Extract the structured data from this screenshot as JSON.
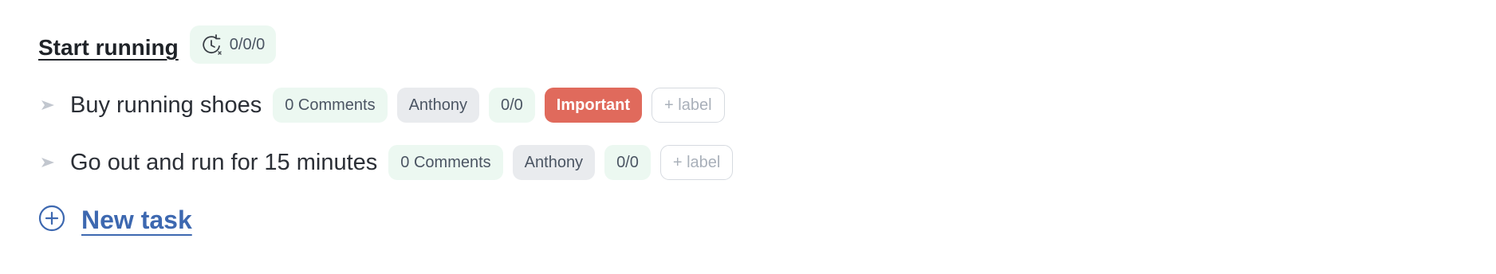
{
  "list": {
    "title": "Start running",
    "progress": "0/0/0",
    "icon": "clock-refresh-icon"
  },
  "tasks": [
    {
      "name": "Buy running shoes",
      "comments": "0 Comments",
      "assignee": "Anthony",
      "progress": "0/0",
      "label": "Important",
      "add_label": "+ label"
    },
    {
      "name": "Go out and run for 15 minutes",
      "comments": "0 Comments",
      "assignee": "Anthony",
      "progress": "0/0",
      "add_label": "+ label"
    }
  ],
  "new_task": {
    "label": "New task",
    "icon": "plus-circle-icon"
  },
  "colors": {
    "accent": "#3d68b0",
    "important": "#e06a5c",
    "chip_green": "#ecf8f1",
    "chip_gray": "#e9ebee"
  }
}
